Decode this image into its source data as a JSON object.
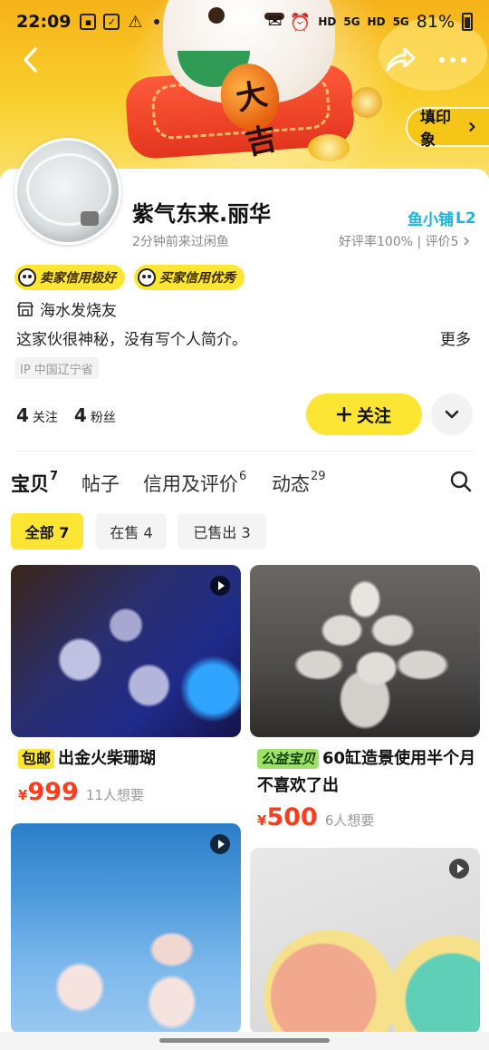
{
  "status_bar": {
    "time": "22:09",
    "network_labels": [
      "HD",
      "5G",
      "HD",
      "5G"
    ],
    "battery": "81%"
  },
  "header": {
    "imprint_label": "填印象",
    "coin_text": "大吉"
  },
  "profile": {
    "nickname": "紫气东来.丽华",
    "last_seen": "2分钟前来过闲鱼",
    "shop_level_name": "鱼小铺",
    "shop_level": "L2",
    "rating_text": "好评率100% | 评价5",
    "badges": {
      "seller": "卖家信用极好",
      "buyer": "买家信用优秀"
    },
    "hobby": "海水发烧友",
    "bio": "这家伙很神秘，没有写个人简介。",
    "bio_more": "更多",
    "ip_location": "IP 中国辽宁省",
    "following_count": "4",
    "following_label": "关注",
    "followers_count": "4",
    "followers_label": "粉丝",
    "follow_button": "关注"
  },
  "tabs": [
    {
      "label": "宝贝",
      "count": "7",
      "active": true
    },
    {
      "label": "帖子",
      "count": ""
    },
    {
      "label": "信用及评价",
      "count": "6"
    },
    {
      "label": "动态",
      "count": "29"
    }
  ],
  "filters": [
    {
      "label": "全部 7",
      "active": true
    },
    {
      "label": "在售 4"
    },
    {
      "label": "已售出 3"
    }
  ],
  "products": [
    {
      "tag": "包邮",
      "title": "出金火柴珊瑚",
      "currency": "¥",
      "price": "999",
      "wants": "11人想要",
      "video": true
    },
    {
      "tag": "公益宝贝",
      "title": "60缸造景使用半个月不喜欢了出",
      "currency": "¥",
      "price": "500",
      "wants": "6人想要",
      "video": false
    },
    {
      "tag": "",
      "title": "",
      "price": "",
      "wants": "",
      "video": true
    },
    {
      "tag": "",
      "title": "",
      "price": "",
      "wants": "",
      "video": true
    }
  ],
  "colors": {
    "brand_yellow": "#fde534",
    "price_red": "#ff3c1e",
    "level_cyan": "#1cb5d6"
  }
}
